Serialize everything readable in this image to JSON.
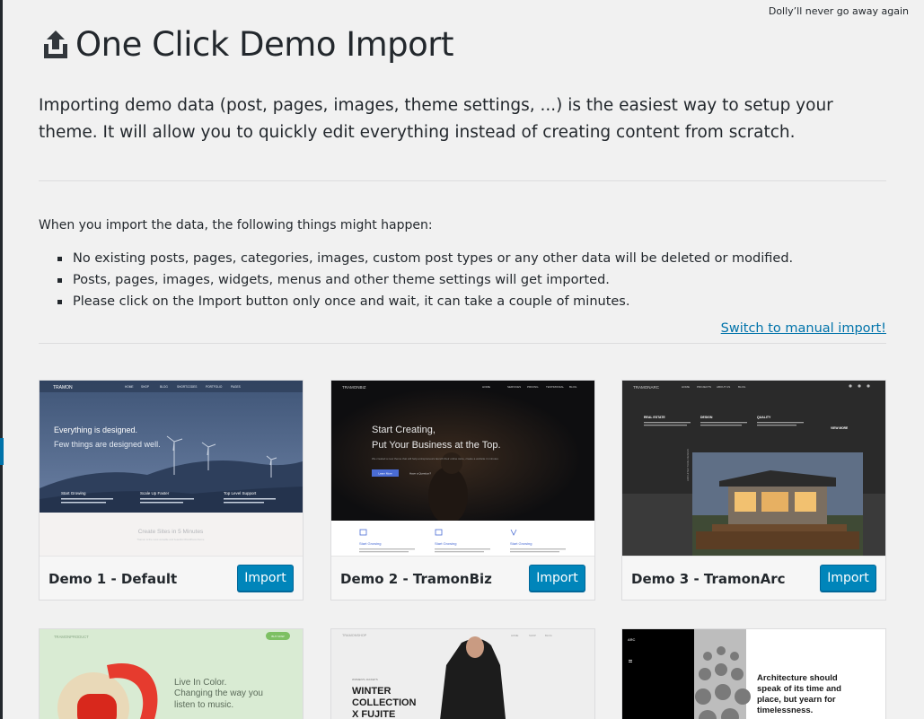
{
  "dolly": "Dolly’ll never go away again",
  "title": "One Click Demo Import",
  "intro": "Importing demo data (post, pages, images, theme settings, ...) is the easiest way to setup your theme. It will allow you to quickly edit everything instead of creating content from scratch.",
  "lead": "When you import the data, the following things might happen:",
  "bullets": [
    "No existing posts, pages, categories, images, custom post types or any other data will be deleted or modified.",
    "Posts, pages, images, widgets, menus and other theme settings will get imported.",
    "Please click on the Import button only once and wait, it can take a couple of minutes."
  ],
  "switch_link": "Switch to manual import!",
  "import_label": "Import",
  "demos": [
    {
      "name": "Demo 1 - Default",
      "logo": "TRAMON",
      "nav": [
        "HOME",
        "SHOP",
        "BLOG",
        "SHORTCODES",
        "PORTFOLIO",
        "PAGES"
      ],
      "headline1": "Everything is designed.",
      "headline2": "Few things are designed well.",
      "features": [
        "Start Growing",
        "Scale Up Faster",
        "Top Level Support"
      ],
      "caption": "Create Sites in 5 Minutes",
      "caption_sub": "Tramon is the most versatile and beautiful WordPress theme"
    },
    {
      "name": "Demo 2 - TramonBiz",
      "logo": "TRAMONBIZ",
      "nav": [
        "HOME",
        "SERVICES",
        "PRICING",
        "TESTIMONIAL",
        "BLOG"
      ],
      "headline1": "Start Creating,",
      "headline2": "Put Your Business at the Top.",
      "tagline": "We created a new theme that will help entrepreneurs launch their online store, create a website in minutes",
      "btn_primary": "Learn More",
      "btn_secondary": "Have a Question?",
      "features": [
        "Start Growing",
        "Start Growing",
        "Start Growing"
      ]
    },
    {
      "name": "Demo 3 - TramonArc",
      "logo": "TRAMONARC",
      "nav": [
        "HOME",
        "PROJECTS",
        "ABOUT US",
        "BLOG"
      ],
      "columns": [
        "REAL ESTATE",
        "DESIGN",
        "QUALITY"
      ],
      "cta": "VIEW MORE",
      "side_text": "ARCHITECTURE DESIGN"
    },
    {
      "logo": "TRAMONPRODUCT",
      "badge": "BUY NOW",
      "headline1": "Live In Color.",
      "headline2": "Changing the way you listen to music."
    },
    {
      "logo": "TRAMONSHOP",
      "nav": [
        "HOME",
        "SHOP",
        "BLOG"
      ],
      "eyebrow": "WOMEN'S JACKETS",
      "headline": [
        "WINTER",
        "COLLECTION",
        "X FUJITE"
      ]
    },
    {
      "logo": "ARC",
      "quote": "Architecture should speak of its time and place, but yearn for timelessness."
    }
  ],
  "colors": {
    "accent": "#0085ba",
    "link": "#0073aa",
    "background": "#f1f1f1",
    "text": "#23282d"
  }
}
